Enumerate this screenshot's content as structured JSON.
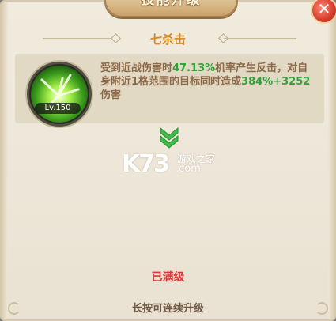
{
  "window": {
    "title": "技能升级",
    "close_label": "✕"
  },
  "skill": {
    "name": "七杀击",
    "level_label": "Lv.150",
    "desc_part1": "受到近战伤害时",
    "desc_rate": "47.13%",
    "desc_part2": "机率产生反击，对自身附近1格范围的目标同时造成",
    "desc_percent": "384%",
    "desc_plus": "+",
    "desc_flat": "3252",
    "desc_part3": "伤害"
  },
  "status": {
    "maxed_label": "已满级",
    "hint_label": "长按可连续升级"
  },
  "watermark": {
    "brand": "K73",
    "cn_text": "游戏之家",
    "domain": ".com"
  },
  "colors": {
    "title_text": "#fff4dc",
    "skill_name": "#d58a1f",
    "highlight_green": "#2fa23a",
    "maxed_red": "#d4393a",
    "desc_brown": "#8e6a4a"
  }
}
